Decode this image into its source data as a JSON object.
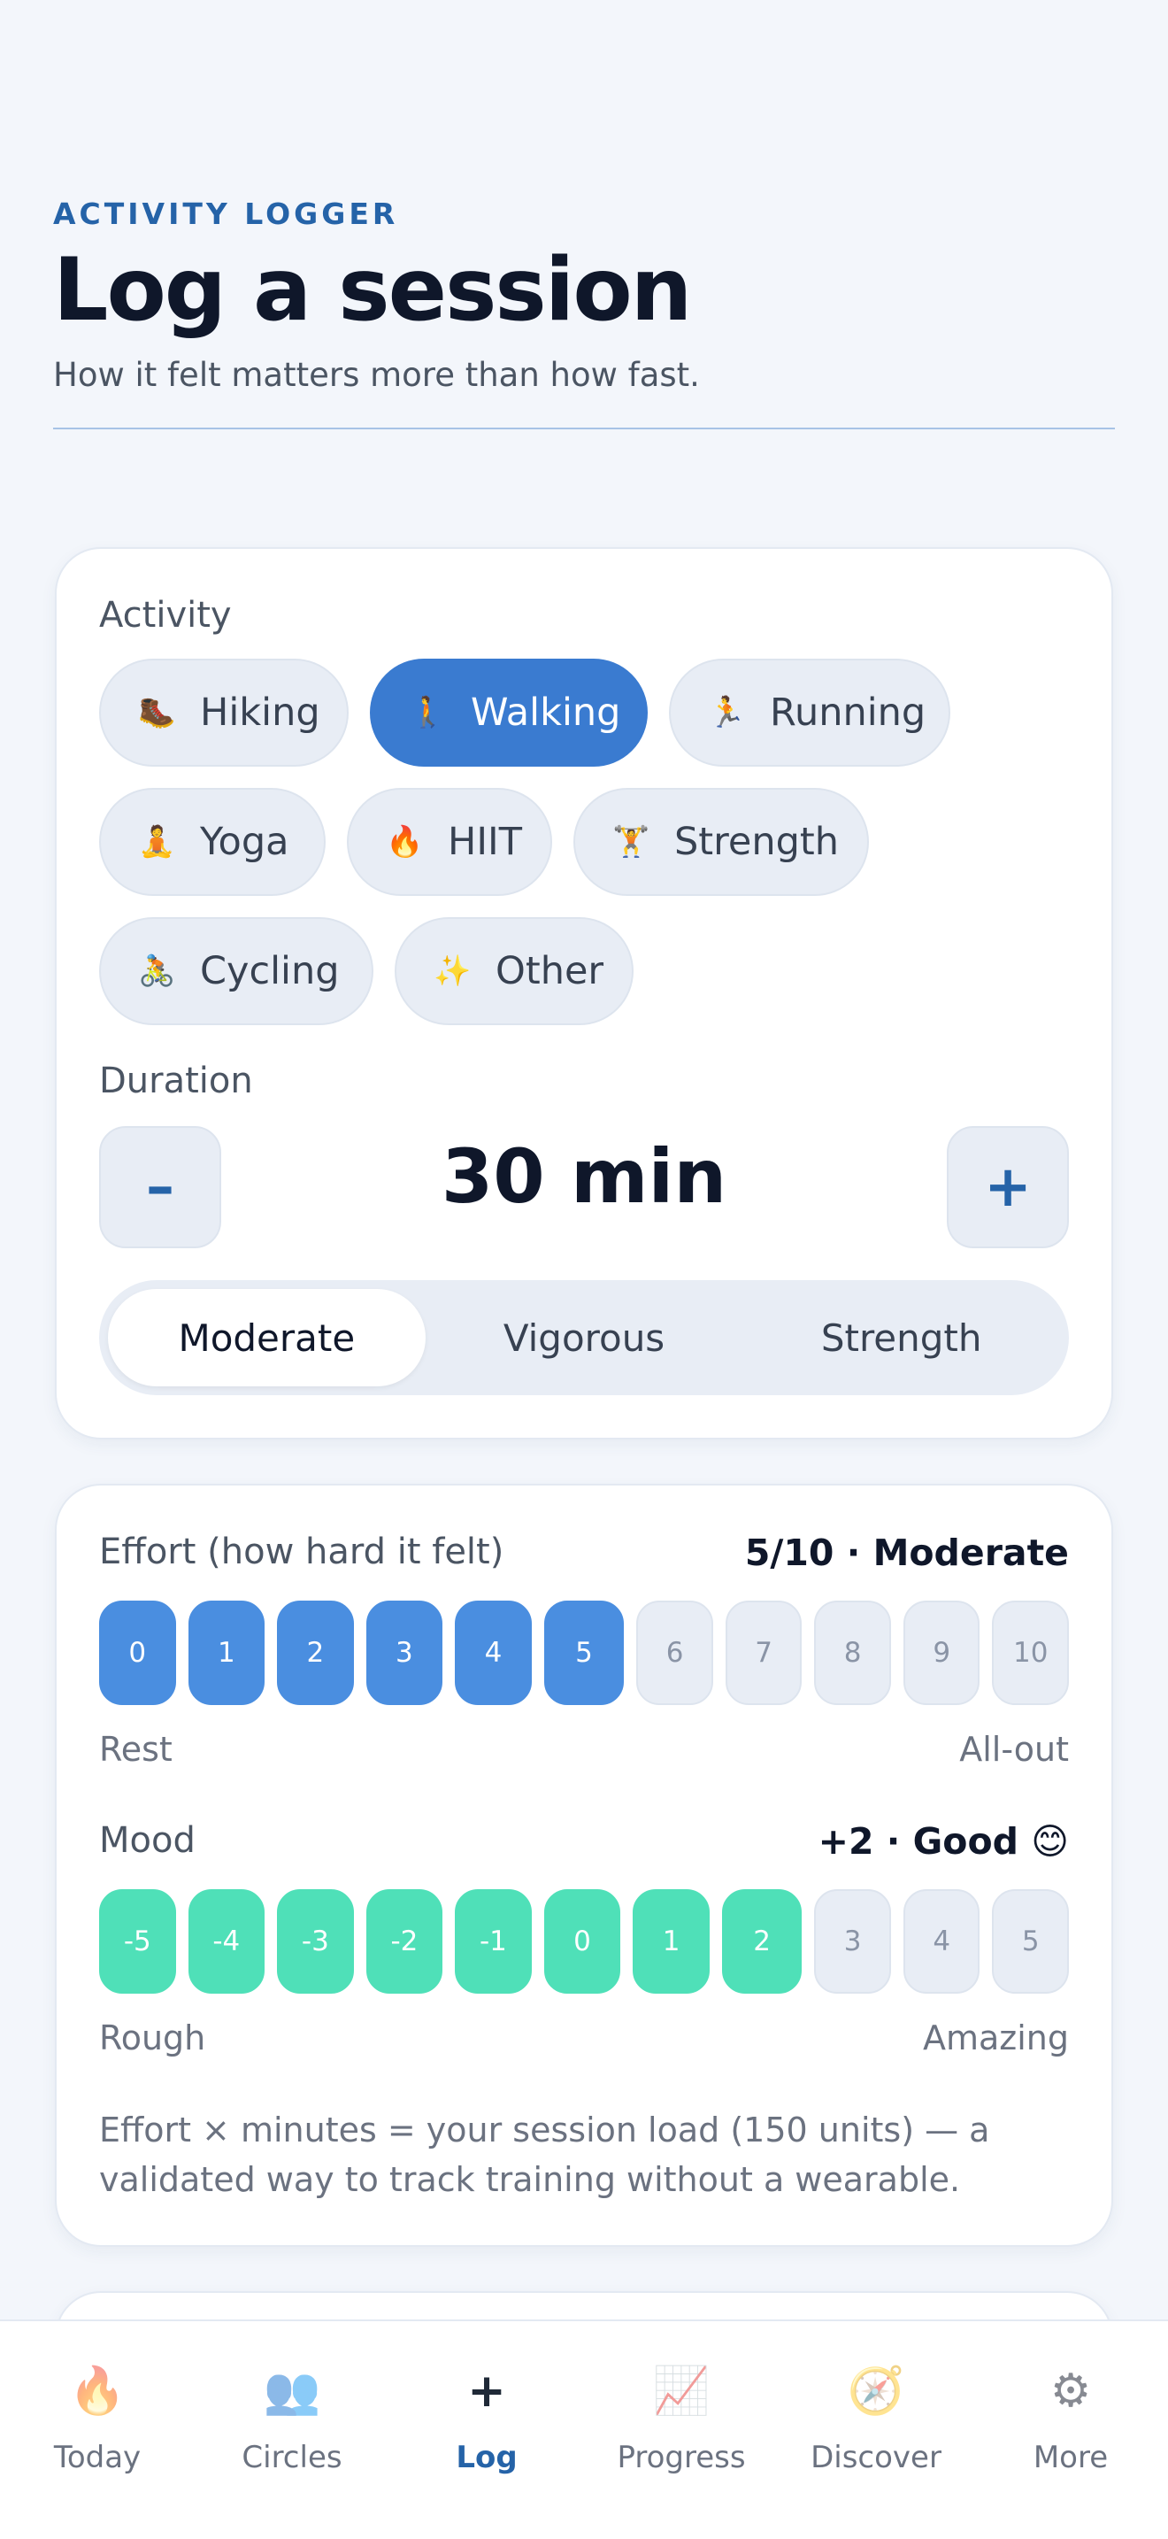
{
  "header": {
    "eyebrow": "ACTIVITY LOGGER",
    "title": "Log a session",
    "subtitle": "How it felt matters more than how fast."
  },
  "activity": {
    "label": "Activity",
    "selected": "Walking",
    "chips": [
      {
        "icon": "🥾",
        "label": "Hiking",
        "active": false
      },
      {
        "icon": "🚶",
        "label": "Walking",
        "active": true
      },
      {
        "icon": "🏃",
        "label": "Running",
        "active": false
      },
      {
        "icon": "🧘",
        "label": "Yoga",
        "active": false
      },
      {
        "icon": "🔥",
        "label": "HIIT",
        "active": false
      },
      {
        "icon": "🏋",
        "label": "Strength",
        "active": false
      },
      {
        "icon": "🚴",
        "label": "Cycling",
        "active": false
      },
      {
        "icon": "✨",
        "label": "Other",
        "active": false
      }
    ]
  },
  "duration": {
    "label": "Duration",
    "minus": "–",
    "plus": "+",
    "value": "30 min"
  },
  "intensity": {
    "options": [
      "Moderate",
      "Vigorous",
      "Strength"
    ],
    "selected": "Moderate"
  },
  "effort": {
    "label": "Effort (how hard it felt)",
    "value_text": "5/10 · Moderate",
    "scale": [
      "0",
      "1",
      "2",
      "3",
      "4",
      "5",
      "6",
      "7",
      "8",
      "9",
      "10"
    ],
    "selected": 5,
    "min_label": "Rest",
    "max_label": "All-out"
  },
  "mood": {
    "label": "Mood",
    "value_text": "+2 · Good 😊",
    "scale": [
      "-5",
      "-4",
      "-3",
      "-2",
      "-1",
      "0",
      "1",
      "2",
      "3",
      "4",
      "5"
    ],
    "selected": 2,
    "min_label": "Rough",
    "max_label": "Amazing"
  },
  "footnote": "Effort × minutes = your session load (150 units) — a validated way to track training without a wearable.",
  "colors": {
    "accent": "#3a7bd0",
    "effort_fill": "#4a8ee0",
    "mood_fill": "#4fe0b8",
    "eyebrow": "#2563a8"
  },
  "tabbar": {
    "active": "Log",
    "tabs": [
      {
        "icon": "🔥",
        "icon_name": "flame-icon",
        "label": "Today"
      },
      {
        "icon": "👥",
        "icon_name": "people-icon",
        "label": "Circles"
      },
      {
        "icon": "+",
        "icon_name": "plus-icon",
        "label": "Log"
      },
      {
        "icon": "📈",
        "icon_name": "chart-icon",
        "label": "Progress"
      },
      {
        "icon": "🧭",
        "icon_name": "compass-icon",
        "label": "Discover"
      },
      {
        "icon": "⚙",
        "icon_name": "gear-icon",
        "label": "More"
      }
    ]
  }
}
